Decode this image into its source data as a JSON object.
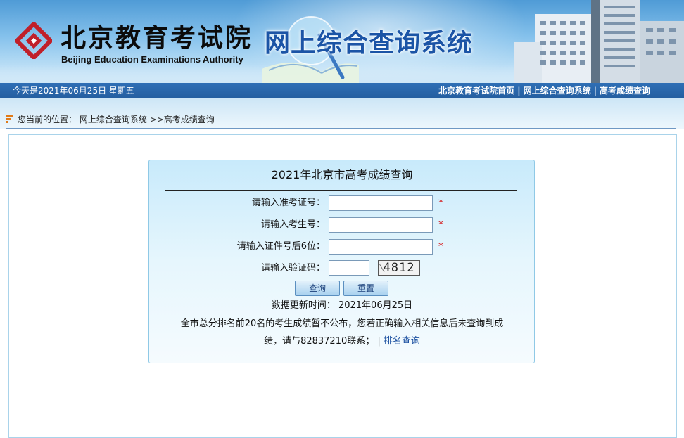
{
  "header": {
    "logo_cn": "北京教育考试院",
    "logo_en": "Beijing Education Examinations Authority",
    "system_title": "网上综合查询系统"
  },
  "navbar": {
    "date": "今天是2021年06月25日  星期五",
    "links": [
      "北京教育考试院首页",
      "网上综合查询系统",
      "高考成绩查询"
    ],
    "separator": "|"
  },
  "breadcrumb": {
    "prefix": "您当前的位置：",
    "system": "网上综合查询系统",
    "current": ">>高考成绩查询"
  },
  "form": {
    "title": "2021年北京市高考成绩查询",
    "fields": [
      {
        "label": "请输入准考证号：",
        "value": "",
        "required": true
      },
      {
        "label": "请输入考生号：",
        "value": "",
        "required": true
      },
      {
        "label": "请输入证件号后6位：",
        "value": "",
        "required": true
      },
      {
        "label": "请输入验证码：",
        "value": "",
        "required": false
      }
    ],
    "required_mark": "*",
    "captcha_text": "4812",
    "submit_label": "查询",
    "reset_label": "重置"
  },
  "info": {
    "update_time": "数据更新时间： 2021年06月25日",
    "notice_line1": "全市总分排名前20名的考生成绩暂不公布，您若正确输入相关信息后未查询到成",
    "notice_line2": "绩，请与82837210联系；",
    "rank_link_sep": "|",
    "rank_link": "排名查询"
  },
  "colors": {
    "brand_blue": "#245ea0",
    "title_blue": "#1b54a6",
    "required_red": "#d40000",
    "panel_bg": "#c8eafb"
  }
}
